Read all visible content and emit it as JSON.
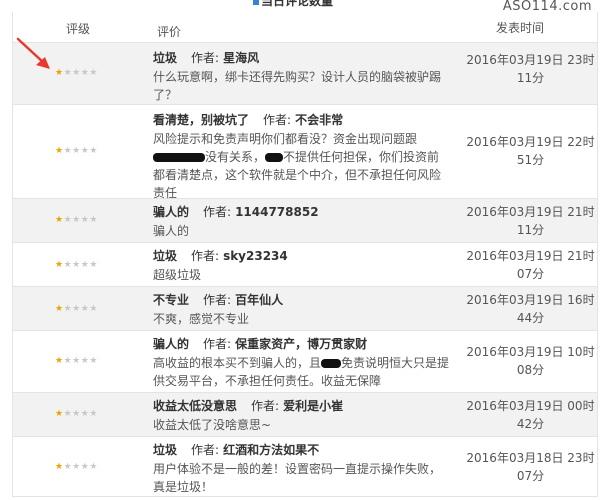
{
  "page": {
    "section_title": "当日评论数量",
    "watermark": "ASO114.com"
  },
  "table": {
    "headers": {
      "rating": "评级",
      "review": "评价",
      "time": "发表时间"
    },
    "author_label": "作者:",
    "max_stars": 5,
    "rows": [
      {
        "stars": 1,
        "title": "垃圾",
        "author": "星海风",
        "body": [
          "什么玩意啊，绑卡还得先购买？设计人员的脑袋被驴踢了？"
        ],
        "time": "2016年03月19日 23时11分"
      },
      {
        "stars": 1,
        "title": "看清楚，别被坑了",
        "author": "不会非常",
        "body": [
          "风险提示和免责声明你们都看没？资金出现问题跟",
          "没有关系，",
          "不提供任何担保，你们投资前都看清楚点，这个软件就是个中介，但不承担任何风险责任"
        ],
        "time": "2016年03月19日 22时51分"
      },
      {
        "stars": 1,
        "title": "骗人的",
        "author": "1144778852",
        "body": [
          "骗人的"
        ],
        "time": "2016年03月19日 21时11分"
      },
      {
        "stars": 1,
        "title": "垃圾",
        "author": "sky23234",
        "body": [
          "超级垃圾"
        ],
        "time": "2016年03月19日 21时07分"
      },
      {
        "stars": 1,
        "title": "不专业",
        "author": "百年仙人",
        "body": [
          "不爽，感觉不专业"
        ],
        "time": "2016年03月19日 16时44分"
      },
      {
        "stars": 1,
        "title": "骗人的",
        "author": "保重家资产，博万贯家财",
        "body": [
          "高收益的根本买不到骗人的，且",
          "免责说明恒大只是提供交易平台，不承担任何责任。收益无保障"
        ],
        "time": "2016年03月19日 10时08分"
      },
      {
        "stars": 1,
        "title": "收益太低没意思",
        "author": "爱利是小崔",
        "body": [
          "收益太低了没啥意思~"
        ],
        "time": "2016年03月19日 00时42分"
      },
      {
        "stars": 1,
        "title": "垃圾",
        "author": "红酒和方法如果不",
        "body": [
          "用户体验不是一般的差！设置密码一直提示操作失败，真是垃圾！"
        ],
        "time": "2016年03月18日 23时07分"
      }
    ]
  },
  "colors": {
    "star_on": "#e8a400",
    "star_off": "#c8c8c8",
    "arrow": "#e8392e",
    "row_alt": "#f2f2f2"
  }
}
